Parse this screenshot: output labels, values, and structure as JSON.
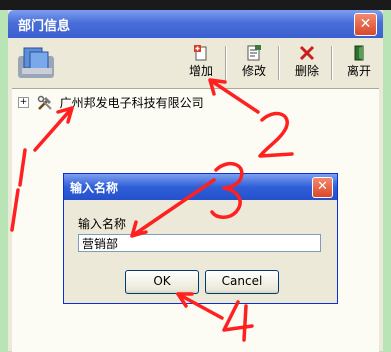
{
  "main_window": {
    "title": "部门信息",
    "close_glyph": "✕",
    "toolbar": {
      "add_label": "增加",
      "edit_label": "修改",
      "delete_label": "删除",
      "exit_label": "离开"
    },
    "tree": {
      "expander_glyph": "+",
      "root_label": "广州邦发电子科技有限公司"
    }
  },
  "dialog": {
    "title": "输入名称",
    "close_glyph": "✕",
    "field_label": "输入名称",
    "field_value": "营销部",
    "ok_label": "OK",
    "cancel_label": "Cancel"
  },
  "icons": {
    "logo": "app-logo-icon",
    "add": "add-document-icon",
    "edit": "edit-document-icon",
    "delete": "delete-x-icon",
    "exit": "exit-door-icon",
    "tree_node": "tools-icon"
  },
  "colors": {
    "title_bar": "#3a5fd0",
    "close_button": "#d9472b",
    "annotation": "#ff2020",
    "desktop": "#b9e5b6"
  }
}
